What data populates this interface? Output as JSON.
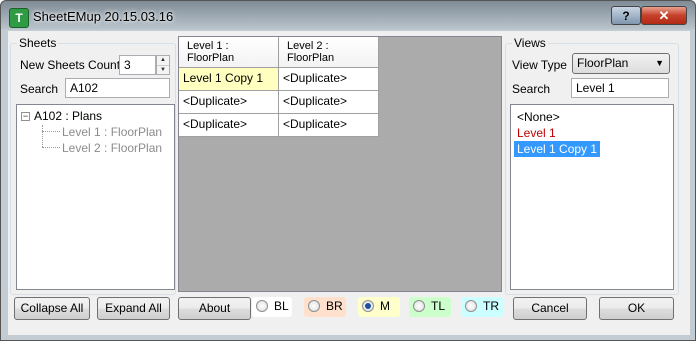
{
  "window": {
    "title": "SheetEMup 20.15.03.16",
    "icon_name": "app-icon",
    "icon_glyph": "T",
    "help_label": "?",
    "close_label": "✕"
  },
  "sheets": {
    "group_title": "Sheets",
    "count_label": "New Sheets Count:",
    "count_value": "3",
    "search_label": "Search",
    "search_value": "A102",
    "tree": {
      "root": "A102 : Plans",
      "root_toggle": "−",
      "children": [
        "Level 1 : FloorPlan",
        "Level 2 : FloorPlan"
      ]
    },
    "collapse_all": "Collapse All",
    "expand_all": "Expand All"
  },
  "grid": {
    "columns": [
      "Level 1 :\nFloorPlan",
      "Level 2 :\nFloorPlan"
    ],
    "rows": [
      [
        "Level 1 Copy 1",
        "<Duplicate>"
      ],
      [
        "<Duplicate>",
        "<Duplicate>"
      ],
      [
        "<Duplicate>",
        "<Duplicate>"
      ]
    ],
    "highlight_color": "#ffffc0",
    "background_color": "#ababab"
  },
  "bottom": {
    "about": "About",
    "positions": [
      {
        "label": "BL",
        "checked": false,
        "color": "#ffffff"
      },
      {
        "label": "BR",
        "checked": false,
        "color": "#ffe0cc"
      },
      {
        "label": "M",
        "checked": true,
        "color": "#ffffcc"
      },
      {
        "label": "TL",
        "checked": false,
        "color": "#ccffcc"
      },
      {
        "label": "TR",
        "checked": false,
        "color": "#ccffff"
      }
    ]
  },
  "views": {
    "group_title": "Views",
    "view_type_label": "View Type",
    "view_type_value": "FloorPlan",
    "search_label": "Search",
    "search_value": "Level 1",
    "items": [
      {
        "label": "<None>",
        "color": "#000000",
        "selected": false
      },
      {
        "label": "Level 1",
        "color": "#c00000",
        "selected": false
      },
      {
        "label": "Level 1 Copy 1",
        "color": "#ffffff",
        "selected": true
      }
    ],
    "selection_color": "#3399ff",
    "cancel": "Cancel",
    "ok": "OK"
  }
}
